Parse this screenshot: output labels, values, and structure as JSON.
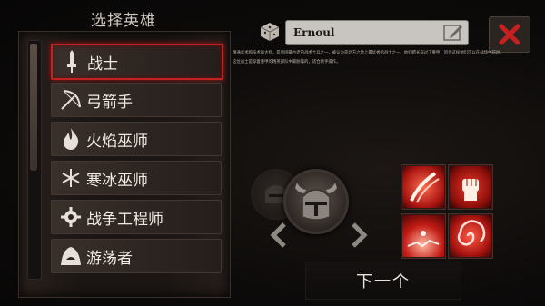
{
  "panel_title": "选择英雄",
  "classes": [
    {
      "label": "战士",
      "icon": "sword-icon",
      "selected": true
    },
    {
      "label": "弓箭手",
      "icon": "bow-icon",
      "selected": false
    },
    {
      "label": "火焰巫师",
      "icon": "flame-icon",
      "selected": false
    },
    {
      "label": "寒冰巫师",
      "icon": "snowflake-icon",
      "selected": false
    },
    {
      "label": "战争工程师",
      "icon": "gear-icon",
      "selected": false
    },
    {
      "label": "游荡者",
      "icon": "hood-icon",
      "selected": false
    }
  ],
  "hero_name": {
    "value": "Ernoul"
  },
  "description": [
    "精通武术和技术的大师。是帝国最古老的战术士兵之一，被认为是北方之地上最优秀的战士之一。他们擅长穿过了重甲，因为这样他们可以在战场中前进。",
    "这位战士是穿着重甲的精英部队中最耐操的，适合新手操作。"
  ],
  "next_button": {
    "label": "下一个"
  },
  "colors": {
    "accent": "#c32222",
    "panel": "#2c2420",
    "background": "#0b0908"
  }
}
